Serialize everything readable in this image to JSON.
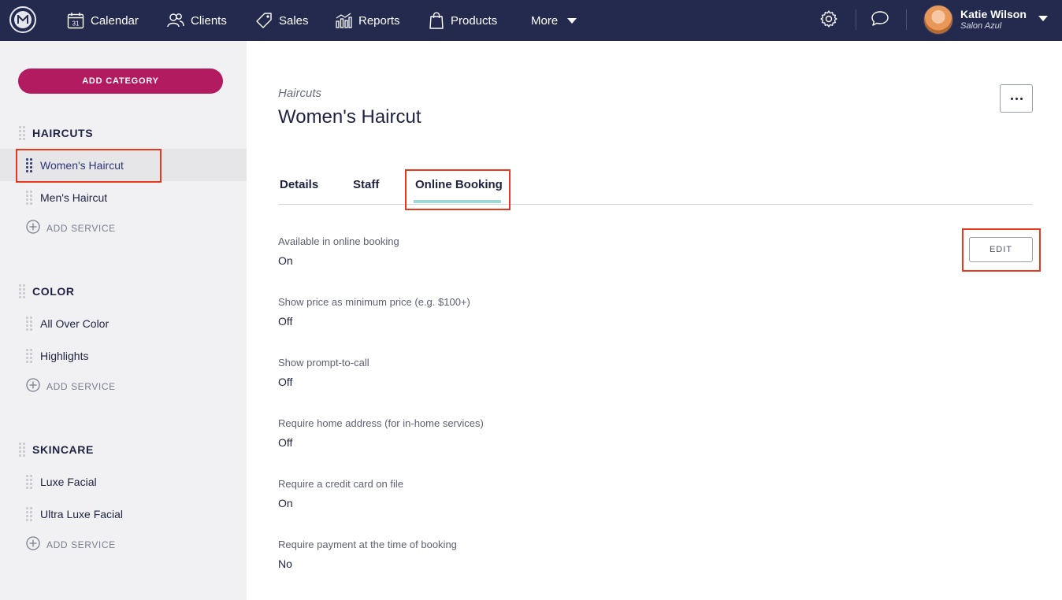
{
  "nav": {
    "items": [
      {
        "label": "Calendar",
        "icon": "calendar-icon"
      },
      {
        "label": "Clients",
        "icon": "clients-icon"
      },
      {
        "label": "Sales",
        "icon": "tag-icon"
      },
      {
        "label": "Reports",
        "icon": "bar-chart-icon"
      },
      {
        "label": "Products",
        "icon": "shopping-bag-icon"
      }
    ],
    "more_label": "More",
    "calendar_day": "31",
    "user": {
      "name": "Katie Wilson",
      "salon": "Salon Azul"
    }
  },
  "sidebar": {
    "add_category_label": "ADD CATEGORY",
    "add_service_label": "ADD SERVICE",
    "categories": [
      {
        "title": "HAIRCUTS",
        "services": [
          "Women's Haircut",
          "Men's Haircut"
        ]
      },
      {
        "title": "COLOR",
        "services": [
          "All Over Color",
          "Highlights"
        ]
      },
      {
        "title": "SKINCARE",
        "services": [
          "Luxe Facial",
          "Ultra Luxe Facial"
        ]
      }
    ],
    "active_service": "Women's Haircut"
  },
  "main": {
    "breadcrumb": "Haircuts",
    "title": "Women's Haircut",
    "tabs": [
      {
        "label": "Details"
      },
      {
        "label": "Staff"
      },
      {
        "label": "Online Booking"
      }
    ],
    "active_tab": "Online Booking",
    "edit_label": "EDIT",
    "fields": [
      {
        "label": "Available in online booking",
        "value": "On"
      },
      {
        "label": "Show price as minimum price (e.g. $100+)",
        "value": "Off"
      },
      {
        "label": "Show prompt-to-call",
        "value": "Off"
      },
      {
        "label": "Require home address (for in-home services)",
        "value": "Off"
      },
      {
        "label": "Require a credit card on file",
        "value": "On"
      },
      {
        "label": "Require payment at the time of booking",
        "value": "No"
      }
    ]
  },
  "colors": {
    "nav_bg": "#232a4d",
    "accent": "#b21b5f",
    "tab_underline": "#9fd8d6",
    "highlight_box": "#e8391d"
  }
}
